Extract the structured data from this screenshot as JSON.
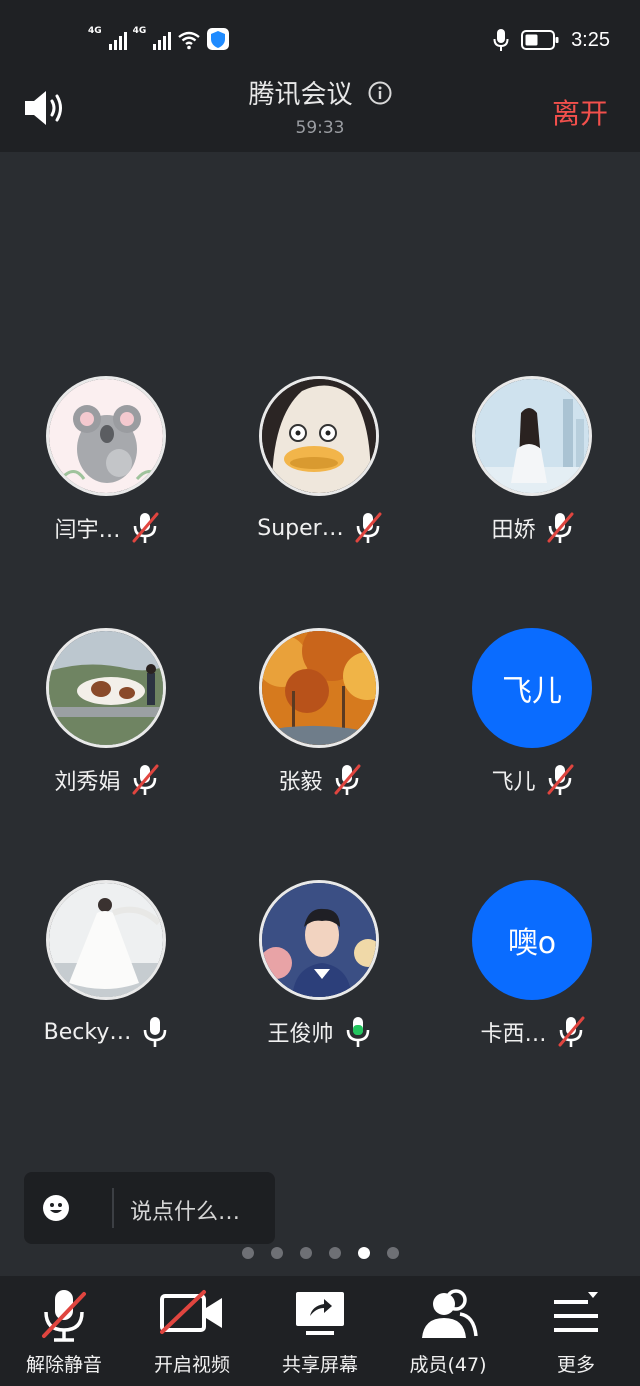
{
  "status_bar": {
    "network_1": "4G",
    "network_2": "4G",
    "time": "3:25"
  },
  "header": {
    "title": "腾讯会议",
    "timer": "59:33",
    "leave_label": "离开"
  },
  "participants": [
    {
      "name": "闫宇…",
      "avatar_type": "koala-illustration",
      "mic": "muted"
    },
    {
      "name": "Super…",
      "avatar_type": "duck-costume-photo",
      "mic": "muted"
    },
    {
      "name": "田娇",
      "avatar_type": "woman-city-photo",
      "mic": "muted"
    },
    {
      "name": "刘秀娟",
      "avatar_type": "cow-photo",
      "mic": "muted"
    },
    {
      "name": "张毅",
      "avatar_type": "autumn-forest-photo",
      "mic": "muted"
    },
    {
      "name": "飞儿",
      "avatar_text": "飞儿",
      "mic": "muted"
    },
    {
      "name": "Becky…",
      "avatar_type": "bride-photo",
      "mic": "on"
    },
    {
      "name": "王俊帅",
      "avatar_type": "cartoon-man-illustration",
      "mic": "speaking"
    },
    {
      "name": "卡西…",
      "avatar_text": "噢o",
      "mic": "muted"
    }
  ],
  "chat": {
    "placeholder": "说点什么…"
  },
  "pager": {
    "pages": 6,
    "active_index": 4
  },
  "toolbar": {
    "unmute_label": "解除静音",
    "video_label": "开启视频",
    "share_label": "共享屏幕",
    "members_label": "成员(47)",
    "more_label": "更多"
  },
  "colors": {
    "accent": "#0a6cff",
    "leave": "#f2504c",
    "mute_slash": "#e0453f",
    "speaking": "#22c55e"
  }
}
